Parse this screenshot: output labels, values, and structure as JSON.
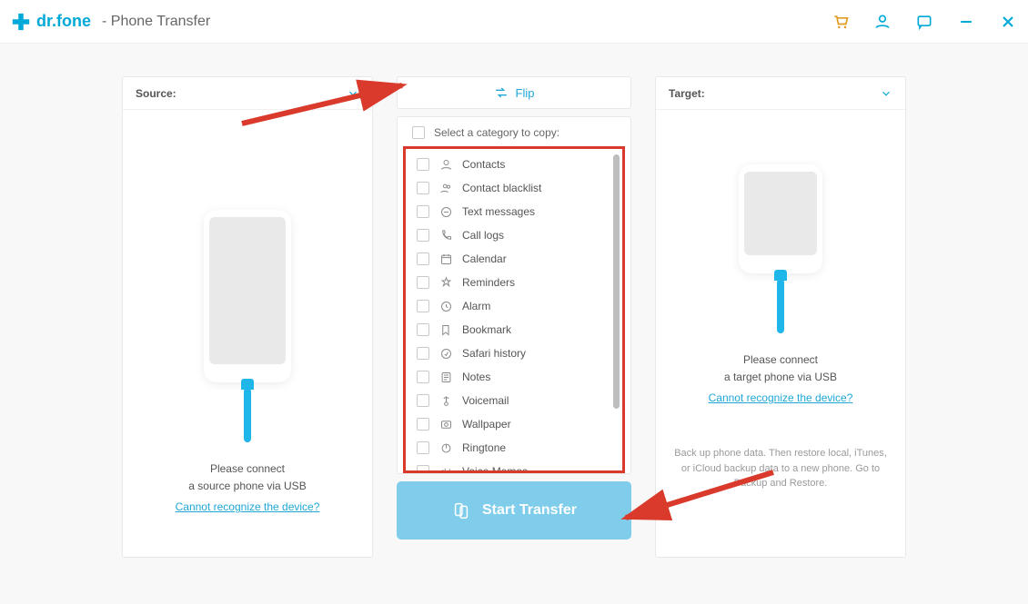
{
  "app": {
    "brand": "dr.fone",
    "module": "- Phone Transfer"
  },
  "source": {
    "label": "Source:",
    "hint1": "Please connect",
    "hint2": "a source phone via USB",
    "link": "Cannot recognize the device?"
  },
  "target": {
    "label": "Target:",
    "hint1": "Please connect",
    "hint2": "a target phone via USB",
    "link": "Cannot recognize the device?",
    "note": "Back up phone data. Then restore local, iTunes, or iCloud backup data to a new phone. Go to Backup and Restore."
  },
  "center": {
    "flip": "Flip",
    "selectPrompt": "Select a category to copy:",
    "start": "Start Transfer",
    "categories": [
      "Contacts",
      "Contact blacklist",
      "Text messages",
      "Call logs",
      "Calendar",
      "Reminders",
      "Alarm",
      "Bookmark",
      "Safari history",
      "Notes",
      "Voicemail",
      "Wallpaper",
      "Ringtone",
      "Voice Memos"
    ]
  }
}
